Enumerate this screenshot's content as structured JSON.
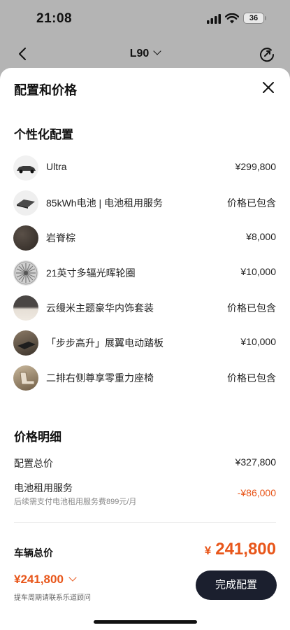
{
  "status_bar": {
    "time": "21:08",
    "battery": "36"
  },
  "nav": {
    "title": "L90"
  },
  "sheet": {
    "title": "配置和价格",
    "config_section_title": "个性化配置",
    "items": [
      {
        "name": "Ultra",
        "price": "¥299,800"
      },
      {
        "name": "85kWh电池 | 电池租用服务",
        "price": "价格已包含"
      },
      {
        "name": "岩脊棕",
        "price": "¥8,000"
      },
      {
        "name": "21英寸多辐光晖轮圈",
        "price": "¥10,000"
      },
      {
        "name": "云缦米主题豪华内饰套装",
        "price": "价格已包含"
      },
      {
        "name": "「步步高升」展翼电动踏板",
        "price": "¥10,000"
      },
      {
        "name": "二排右侧尊享零重力座椅",
        "price": "价格已包含"
      }
    ],
    "price_section_title": "价格明细",
    "config_total_label": "配置总价",
    "config_total_value": "¥327,800",
    "battery_rental_label": "电池租用服务",
    "battery_rental_note": "后续需支付电池租用服务费899元/月",
    "battery_rental_value": "-¥86,000",
    "vehicle_total_label": "车辆总价",
    "vehicle_total_currency": "¥",
    "vehicle_total_value": "241,800"
  },
  "footer": {
    "price": "¥241,800",
    "note": "提车周期请联系乐道顾问",
    "done_button": "完成配置"
  },
  "colors": {
    "accent": "#e8561a",
    "button_bg": "#1b1f2e"
  }
}
